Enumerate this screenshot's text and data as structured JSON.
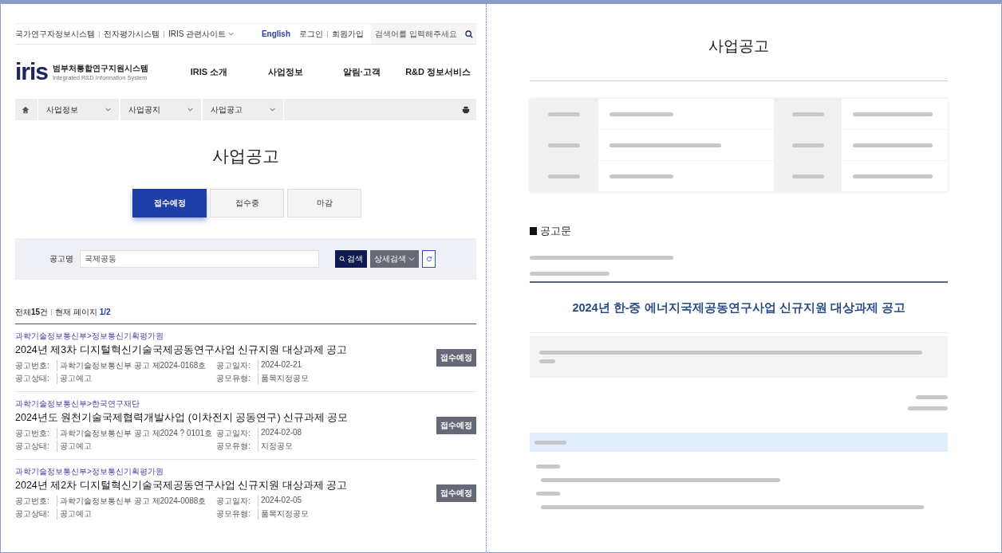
{
  "left_page": {
    "utility_links": [
      "국가연구자정보시스템",
      "전자평가시스템"
    ],
    "related_sites_menu": "IRIS 관련사이트",
    "language_link": "English",
    "login": "로그인",
    "signup": "회원가입",
    "search_placeholder": "검색어를 입력해주세요",
    "logo": {
      "mark": "iris",
      "name": "범부처통합연구지원시스템",
      "subtitle": "Integrated R&D Information System"
    },
    "nav": [
      "IRIS 소개",
      "사업정보",
      "알림·고객",
      "R&D 정보서비스"
    ],
    "breadcrumb": [
      "사업정보",
      "사업공지",
      "사업공고"
    ],
    "page_title": "사업공고",
    "tabs": [
      {
        "label": "접수예정",
        "selected": true
      },
      {
        "label": "접수중",
        "selected": false
      },
      {
        "label": "마감",
        "selected": false
      }
    ],
    "search": {
      "label": "공고명",
      "value": "국제공동",
      "search_button": "검색",
      "detail_button": "상세검색"
    },
    "summary": {
      "total": "전체**15**건",
      "page": "현재 페이지 **1/2**"
    },
    "announcements": [
      {
        "agency": "과학기술정보통신부>정보통신기획평가원",
        "title": "2024년 제3차 디지털혁신기술국제공동연구사업 신규지원 대상과제 공고",
        "number_label": "공고번호:",
        "number": "과학기술정보통신부 공고 제2024-0168호",
        "date_label": "공고일자:",
        "date": "2024-02-21",
        "status_label": "공고상태:",
        "status": "공고예고",
        "type_label": "공모유형:",
        "type": "품목지정공모",
        "badge": "접수예정"
      },
      {
        "agency": "과학기술정보통신부>한국연구재단",
        "title": "2024년도 원천기술국제협력개발사업 (이차전지 공동연구) 신규과제 공모",
        "number_label": "공고번호:",
        "number": "과학기술정보통신부 공고 제2024 ? 0101호",
        "date_label": "공고일자:",
        "date": "2024-02-08",
        "status_label": "공고상태:",
        "status": "공고예고",
        "type_label": "공모유형:",
        "type": "지정공모",
        "badge": "접수예정"
      },
      {
        "agency": "과학기술정보통신부>정보통신기획평가원",
        "title": "2024년 제2차 디지털혁신기술국제공동연구사업 신규지원 대상과제 공고",
        "number_label": "공고번호:",
        "number": "과학기술정보통신부 공고 제2024-0088호",
        "date_label": "공고일자:",
        "date": "2024-02-05",
        "status_label": "공고상태:",
        "status": "공고예고",
        "type_label": "공모유형:",
        "type": "품목지정공모",
        "badge": "접수예정"
      }
    ]
  },
  "right_page": {
    "title": "사업공고",
    "section_heading": "공고문",
    "headline": "2024년 한-중 에너지국제공동연구사업 신규지원 대상과제 공고"
  }
}
